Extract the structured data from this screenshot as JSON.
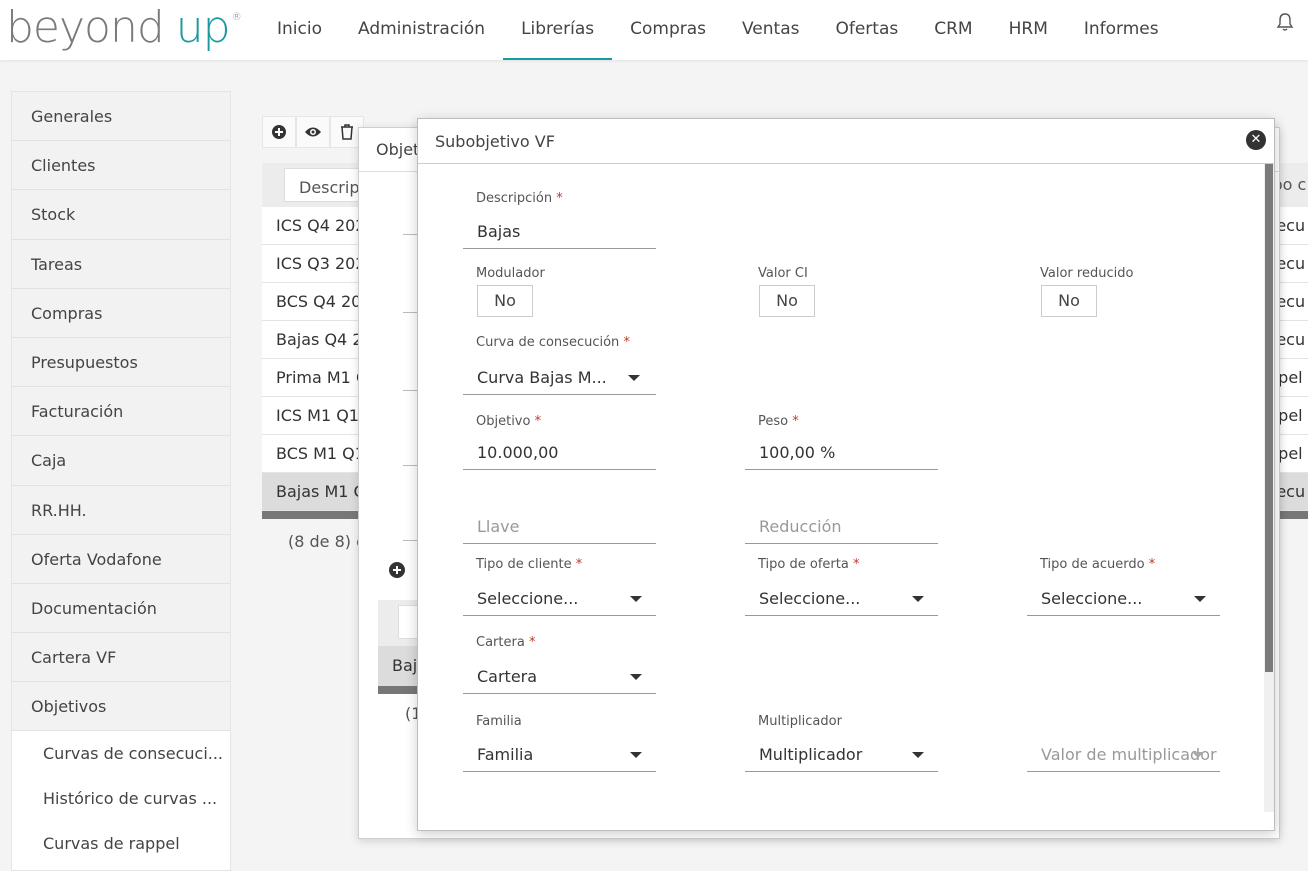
{
  "logo": {
    "part1": "beyond",
    "part2": "up",
    "reg": "®"
  },
  "nav": {
    "items": [
      "Inicio",
      "Administración",
      "Librerías",
      "Compras",
      "Ventas",
      "Ofertas",
      "CRM",
      "HRM",
      "Informes"
    ],
    "active": "Librerías"
  },
  "sidebar": {
    "items": [
      "Generales",
      "Clientes",
      "Stock",
      "Tareas",
      "Compras",
      "Presupuestos",
      "Facturación",
      "Caja",
      "RR.HH.",
      "Oferta Vodafone",
      "Documentación",
      "Cartera VF",
      "Objetivos"
    ],
    "subitems": [
      "Curvas de consecuci...",
      "Histórico de curvas ...",
      "Curvas de rappel"
    ]
  },
  "background_table": {
    "filter_placeholder": "Descrip",
    "rows": [
      {
        "desc": "ICS Q4 202",
        "right": "secu"
      },
      {
        "desc": "ICS Q3 202",
        "right": "secu"
      },
      {
        "desc": "BCS Q4 20",
        "right": "secu"
      },
      {
        "desc": "Bajas Q4 2",
        "right": "secu"
      },
      {
        "desc": "Prima M1 C",
        "right": "ppel"
      },
      {
        "desc": "ICS M1 Q1",
        "right": "ppel"
      },
      {
        "desc": "BCS M1 Q1",
        "right": "ppel"
      },
      {
        "desc": "Bajas M1 C",
        "right": "secu"
      }
    ],
    "header_right": "ipo c",
    "pager": "(8 de 8) e"
  },
  "modal_objetivo": {
    "title": "Objet",
    "row": "Baj",
    "pager": "(1"
  },
  "modal_subobjetivo": {
    "title": "Subobjetivo VF",
    "close": "✕",
    "fields": {
      "descripcion": {
        "label": "Descripción",
        "required": "*",
        "value": "Bajas"
      },
      "modulador": {
        "label": "Modulador",
        "value": "No"
      },
      "valor_ci": {
        "label": "Valor CI",
        "value": "No"
      },
      "valor_reducido": {
        "label": "Valor reducido",
        "value": "No"
      },
      "curva": {
        "label": "Curva de consecución",
        "required": "*",
        "value": "Curva Bajas M..."
      },
      "objetivo": {
        "label": "Objetivo",
        "required": "*",
        "value": "10.000,00"
      },
      "peso": {
        "label": "Peso",
        "required": "*",
        "value": "100,00 %"
      },
      "llave": {
        "placeholder": "Llave"
      },
      "reduccion": {
        "placeholder": "Reducción"
      },
      "tipo_cliente": {
        "label": "Tipo de cliente",
        "required": "*",
        "value": "Seleccione..."
      },
      "tipo_oferta": {
        "label": "Tipo de oferta",
        "required": "*",
        "value": "Seleccione..."
      },
      "tipo_acuerdo": {
        "label": "Tipo de acuerdo",
        "required": "*",
        "value": "Seleccione..."
      },
      "cartera": {
        "label": "Cartera",
        "required": "*",
        "value": "Cartera"
      },
      "familia": {
        "label": "Familia",
        "value": "Familia"
      },
      "multiplicador": {
        "label": "Multiplicador",
        "value": "Multiplicador"
      },
      "valor_multiplicador": {
        "placeholder": "Valor de multiplicador"
      }
    }
  },
  "colors": {
    "accent": "#1a9aa0",
    "required": "#c0392b"
  }
}
